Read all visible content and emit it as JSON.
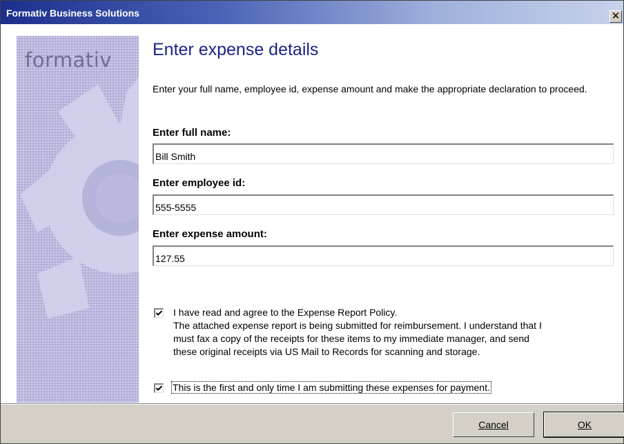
{
  "window": {
    "title": "Formativ Business Solutions",
    "close_glyph": "✕"
  },
  "side_panel": {
    "logo_text": "formativ"
  },
  "main": {
    "heading": "Enter expense details",
    "intro": "Enter your full name, employee id, expense amount and make the appropriate declaration to proceed."
  },
  "fields": {
    "full_name": {
      "label": "Enter full name:",
      "value": "Bill Smith"
    },
    "employee_id": {
      "label": "Enter employee id:",
      "value": "555-5555"
    },
    "expense_amount": {
      "label": "Enter expense amount:",
      "value": "127.55"
    }
  },
  "declarations": {
    "policy": {
      "checked": true,
      "lines": [
        "I have read and agree to the Expense Report Policy.",
        "The attached expense report is being submitted for reimbursement. I understand that I",
        "must fax a copy of the receipts for these items to my immediate manager, and send",
        "these original receipts via US Mail to Records for scanning and storage."
      ]
    },
    "first_time": {
      "checked": true,
      "label": "This is the first and only time I am submitting these expenses for payment."
    }
  },
  "buttons": {
    "cancel": "Cancel",
    "ok": "OK"
  },
  "icons": {
    "close": "close-icon",
    "check": "checkmark-icon"
  }
}
